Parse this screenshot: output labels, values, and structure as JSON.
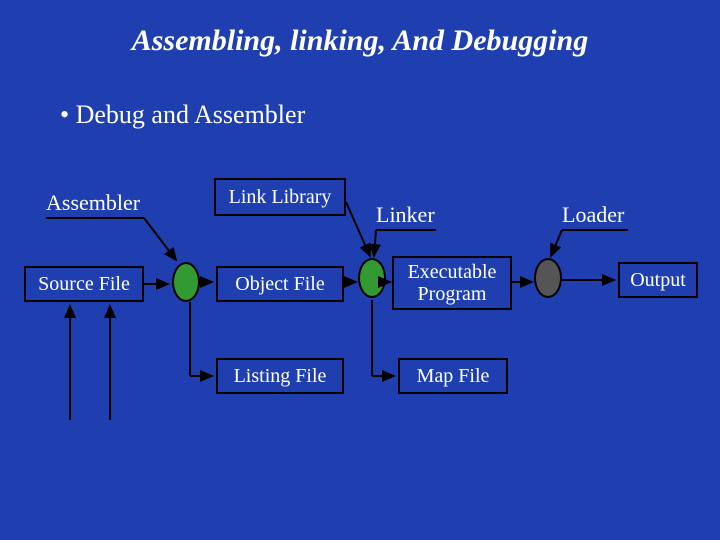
{
  "title": "Assembling, linking, And Debugging",
  "bullet": "•  Debug and Assembler",
  "labels": {
    "assembler": "Assembler",
    "linker": "Linker",
    "loader": "Loader"
  },
  "boxes": {
    "link_library": "Link Library",
    "source_file": "Source File",
    "object_file": "Object File",
    "listing_file": "Listing File",
    "executable_program": "Executable\nProgram",
    "map_file": "Map File",
    "output": "Output"
  }
}
